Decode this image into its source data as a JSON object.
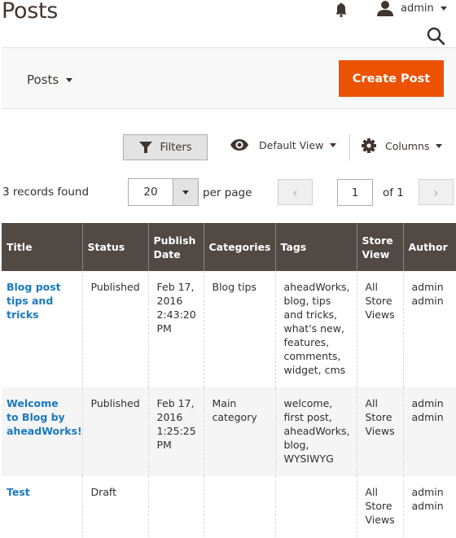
{
  "header": {
    "page_title": "Posts",
    "user_name": "admin",
    "icons": {
      "notifications": "bell-icon",
      "user": "user-icon",
      "search": "search-icon"
    }
  },
  "action_bar": {
    "switcher_label": "Posts",
    "create_button": "Create Post",
    "accent_color": "#eb5202"
  },
  "toolbar": {
    "filters_label": "Filters",
    "view_label": "Default View",
    "columns_label": "Columns"
  },
  "pagination": {
    "records_found": "3 records found",
    "per_page_value": "20",
    "per_page_label": "per page",
    "current_page": "1",
    "of_label": "of 1",
    "prev_glyph": "‹",
    "next_glyph": "›"
  },
  "grid": {
    "columns": [
      "Title",
      "Status",
      "Publish Date",
      "Categories",
      "Tags",
      "Store View",
      "Author"
    ],
    "header_color": "#514943",
    "rows": [
      {
        "title": "Blog post tips and tricks",
        "status": "Published",
        "status_type": "published",
        "publish_date": "Feb 17, 2016 2:43:20 PM",
        "categories": "Blog tips",
        "tags": "aheadWorks, blog, tips and tricks, what's new, features, comments, widget, cms",
        "store_view": "All Store Views",
        "author": "admin admin"
      },
      {
        "title": "Welcome to Blog by aheadWorks!",
        "status": "Published",
        "status_type": "published",
        "publish_date": "Feb 17, 2016 1:25:25 PM",
        "categories": "Main category",
        "tags": "welcome, first post, aheadWorks, blog, WYSIWYG",
        "store_view": "All Store Views",
        "author": "admin admin"
      },
      {
        "title": "Test",
        "status": "Draft",
        "status_type": "draft",
        "publish_date": "",
        "categories": "",
        "tags": "",
        "store_view": "All Store Views",
        "author": "admin admin"
      }
    ]
  }
}
